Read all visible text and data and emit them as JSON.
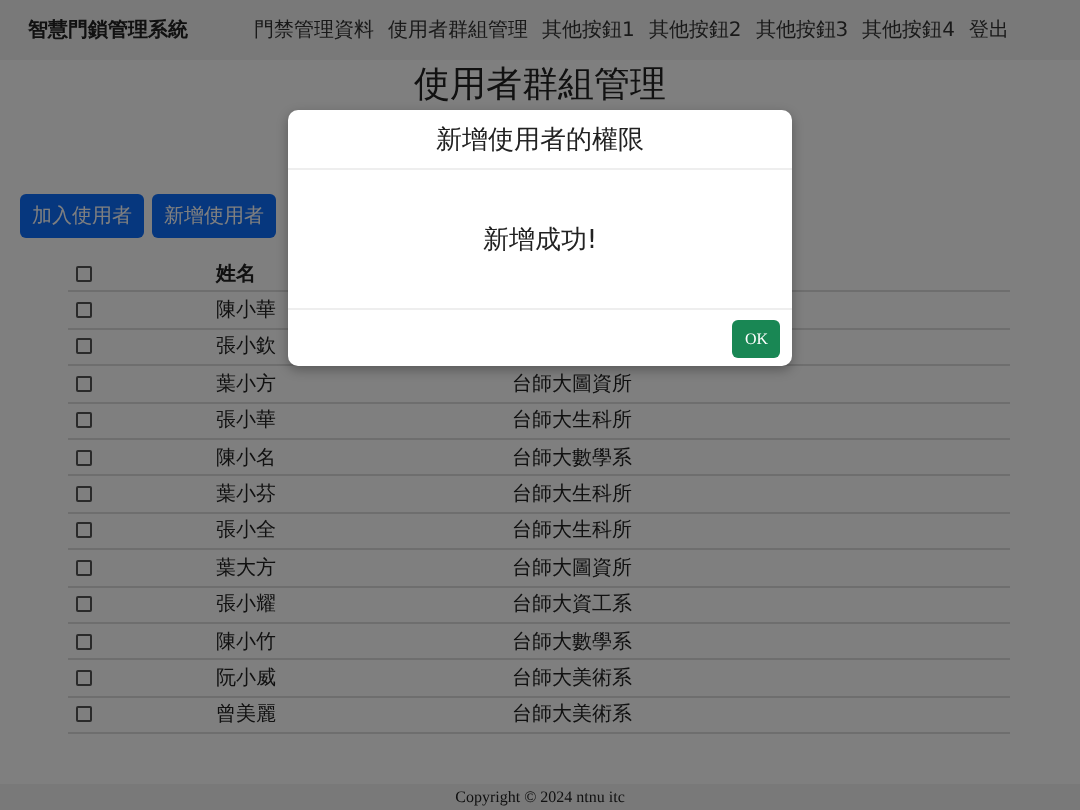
{
  "navbar": {
    "brand": "智慧門鎖管理系統",
    "links": [
      "門禁管理資料",
      "使用者群組管理",
      "其他按鈕1",
      "其他按鈕2",
      "其他按鈕3",
      "其他按鈕4",
      "登出"
    ]
  },
  "page_title": "使用者群組管理",
  "buttons": [
    "加入使用者",
    "新增使用者"
  ],
  "table": {
    "columns": [
      "姓名"
    ],
    "header_checkbox": {
      "checked": false
    },
    "rows": [
      {
        "checked": false,
        "name": "陳小華"
      },
      {
        "checked": false,
        "name": "張小欽"
      },
      {
        "checked": false,
        "name": "葉小方",
        "dept": "台師大圖資所"
      },
      {
        "checked": false,
        "name": "張小華",
        "dept": "台師大生科所"
      },
      {
        "checked": false,
        "name": "陳小名",
        "dept": "台師大數學系"
      },
      {
        "checked": false,
        "name": "葉小芬",
        "dept": "台師大生科所"
      },
      {
        "checked": false,
        "name": "張小全",
        "dept": "台師大生科所"
      },
      {
        "checked": false,
        "name": "葉大方",
        "dept": "台師大圖資所"
      },
      {
        "checked": false,
        "name": "張小耀",
        "dept": "台師大資工系"
      },
      {
        "checked": false,
        "name": "陳小竹",
        "dept": "台師大數學系"
      },
      {
        "checked": false,
        "name": "阮小威",
        "dept": "台師大美術系"
      },
      {
        "checked": false,
        "name": "曾美麗",
        "dept": "台師大美術系"
      }
    ]
  },
  "footer": "Copyright © 2024 ntnu itc",
  "modal": {
    "title": "新增使用者的權限",
    "message": "新增成功!",
    "button": "OK"
  }
}
